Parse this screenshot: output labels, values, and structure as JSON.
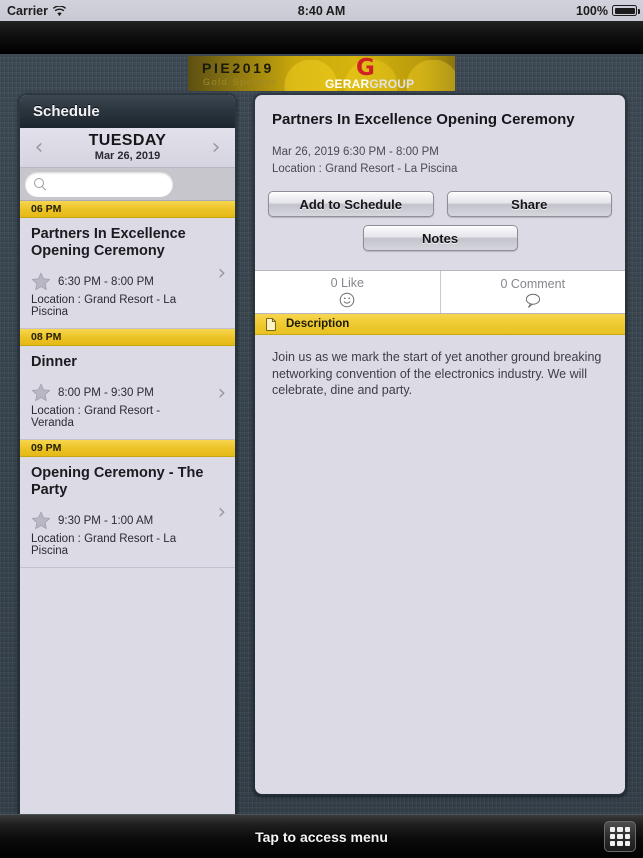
{
  "status_bar": {
    "carrier": "Carrier",
    "wifi_icon": "wifi-icon",
    "time": "8:40 AM",
    "battery_percent": "100%",
    "battery_icon": "battery-full-icon"
  },
  "banner": {
    "event_code": "PIE2019",
    "tier": "Gold Sponsor",
    "logo_mark": "G",
    "brand_bold": "GERAR",
    "brand_light": "GROUP"
  },
  "sidebar": {
    "title": "Schedule",
    "prev_icon": "chevron-left-icon",
    "next_icon": "chevron-right-icon",
    "day": "TUESDAY",
    "date": "Mar 26, 2019",
    "search": {
      "placeholder": "",
      "value": "",
      "icon": "search-icon"
    },
    "groups": [
      {
        "hour": "06 PM",
        "events": [
          {
            "name": "Partners In Excellence Opening Ceremony",
            "time": "6:30 PM - 8:00 PM",
            "location": "Location : Grand Resort - La Piscina",
            "favorite_icon": "star-icon",
            "chevron_icon": "chevron-right-icon"
          }
        ]
      },
      {
        "hour": "08 PM",
        "events": [
          {
            "name": "Dinner",
            "time": "8:00 PM - 9:30 PM",
            "location": "Location : Grand Resort - Veranda",
            "favorite_icon": "star-icon",
            "chevron_icon": "chevron-right-icon"
          }
        ]
      },
      {
        "hour": "09 PM",
        "events": [
          {
            "name": "Opening Ceremony - The Party",
            "time": "9:30 PM - 1:00 AM",
            "location": "Location : Grand Resort - La Piscina",
            "favorite_icon": "star-icon",
            "chevron_icon": "chevron-right-icon"
          }
        ]
      }
    ]
  },
  "detail": {
    "title": "Partners In Excellence Opening Ceremony",
    "when": "Mar 26, 2019 6:30 PM - 8:00 PM",
    "where": "Location : Grand Resort - La Piscina",
    "buttons": {
      "add_to_schedule": "Add to Schedule",
      "share": "Share",
      "notes": "Notes"
    },
    "social": {
      "like_label": "0 Like",
      "like_icon": "smiley-icon",
      "comment_label": "0 Comment",
      "comment_icon": "speech-bubble-icon"
    },
    "description_section": {
      "icon": "document-icon",
      "heading": "Description",
      "body": "Join us as we mark the start of yet another ground breaking networking convention of the electronics industry. We will celebrate, dine and party."
    }
  },
  "menu_bar": {
    "label": "Tap to access menu",
    "grid_icon": "grid-menu-icon"
  },
  "colors": {
    "accent_yellow": "#eec92f",
    "panel_bg": "#dcdae4",
    "chrome_dark": "#2b353e",
    "denim": "#3b4752"
  }
}
